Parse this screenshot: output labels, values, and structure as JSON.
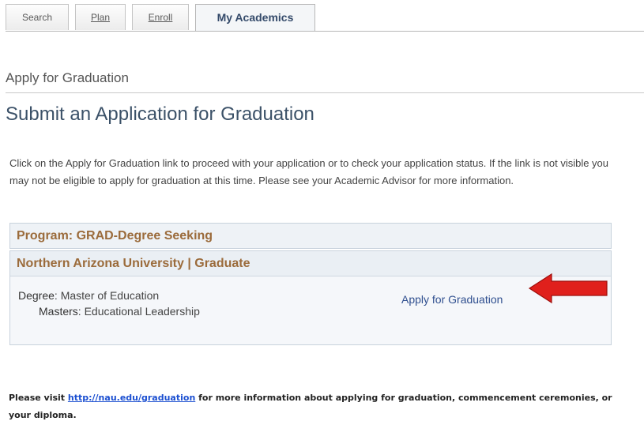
{
  "tabs": [
    {
      "label": "Search"
    },
    {
      "label": "Plan"
    },
    {
      "label": "Enroll"
    },
    {
      "label": "My Academics",
      "active": true
    }
  ],
  "section_title": "Apply for Graduation",
  "page_title": "Submit an Application for Graduation",
  "intro_text": "Click on the Apply for Graduation link to proceed with your application or to check your application status. If the link is not visible you may not be eligible to apply for graduation at this time. Please see your Academic Advisor for more information.",
  "program": {
    "label": "Program: GRAD-Degree Seeking"
  },
  "university": {
    "header": "Northern Arizona University | Graduate",
    "degree_label": "Degree",
    "degree_value": ": Master of Education",
    "masters_label": "Masters",
    "masters_value": ": Educational Leadership",
    "apply_link": "Apply for Graduation"
  },
  "footer": {
    "prefix": "Please visit ",
    "link": "http://nau.edu/graduation",
    "suffix": " for more information about applying for graduation, commencement ceremonies, or your diploma."
  },
  "colors": {
    "annotation_arrow": "#e0201c",
    "heading_brown": "#9b6b3b",
    "link_blue": "#2f4f8f"
  }
}
